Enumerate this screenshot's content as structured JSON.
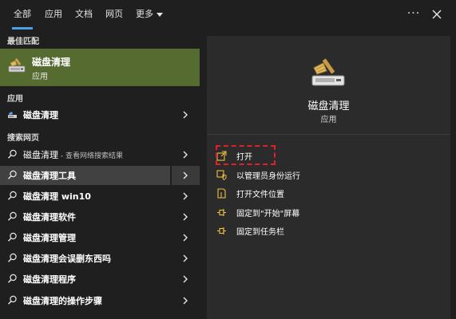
{
  "topbar": {
    "tabs": [
      {
        "label": "全部",
        "active": true
      },
      {
        "label": "应用"
      },
      {
        "label": "文档"
      },
      {
        "label": "网页"
      },
      {
        "label": "更多"
      }
    ],
    "menu_icon": "ellipsis-icon",
    "close_icon": "close-icon"
  },
  "left": {
    "best_match_header": "最佳匹配",
    "best_match": {
      "title": "磁盘清理",
      "subtitle": "应用",
      "icon": "disk-cleanup-icon"
    },
    "apps_header": "应用",
    "apps": [
      {
        "label": "磁盘清理",
        "icon": "disk-cleanup-icon"
      }
    ],
    "web_header": "搜索网页",
    "web_results": [
      {
        "label": "磁盘清理",
        "suffix": " - 查看网络搜索结果",
        "icon": "search-icon"
      },
      {
        "label": "磁盘清理工具",
        "icon": "search-icon",
        "highlighted": true
      },
      {
        "label": "磁盘清理 win10",
        "icon": "search-icon"
      },
      {
        "label": "磁盘清理软件",
        "icon": "search-icon"
      },
      {
        "label": "磁盘清理管理",
        "icon": "search-icon"
      },
      {
        "label": "磁盘清理会误删东西吗",
        "icon": "search-icon"
      },
      {
        "label": "磁盘清理程序",
        "icon": "search-icon"
      },
      {
        "label": "磁盘清理的操作步骤",
        "icon": "search-icon"
      }
    ]
  },
  "right": {
    "app_title": "磁盘清理",
    "app_type": "应用",
    "actions": [
      {
        "label": "打开",
        "icon": "open-icon"
      },
      {
        "label": "以管理员身份运行",
        "icon": "run-as-admin-icon"
      },
      {
        "label": "打开文件位置",
        "icon": "file-location-icon"
      },
      {
        "label": "固定到\"开始\"屏幕",
        "icon": "pin-icon"
      },
      {
        "label": "固定到任务栏",
        "icon": "pin-icon"
      }
    ]
  },
  "colors": {
    "background": "#1f1f1f",
    "panel": "#2b2b2b",
    "best_match_bg": "#556b2f",
    "highlight": "#414141",
    "accent": "#4aa0e6",
    "annotation": "#e0202a"
  }
}
